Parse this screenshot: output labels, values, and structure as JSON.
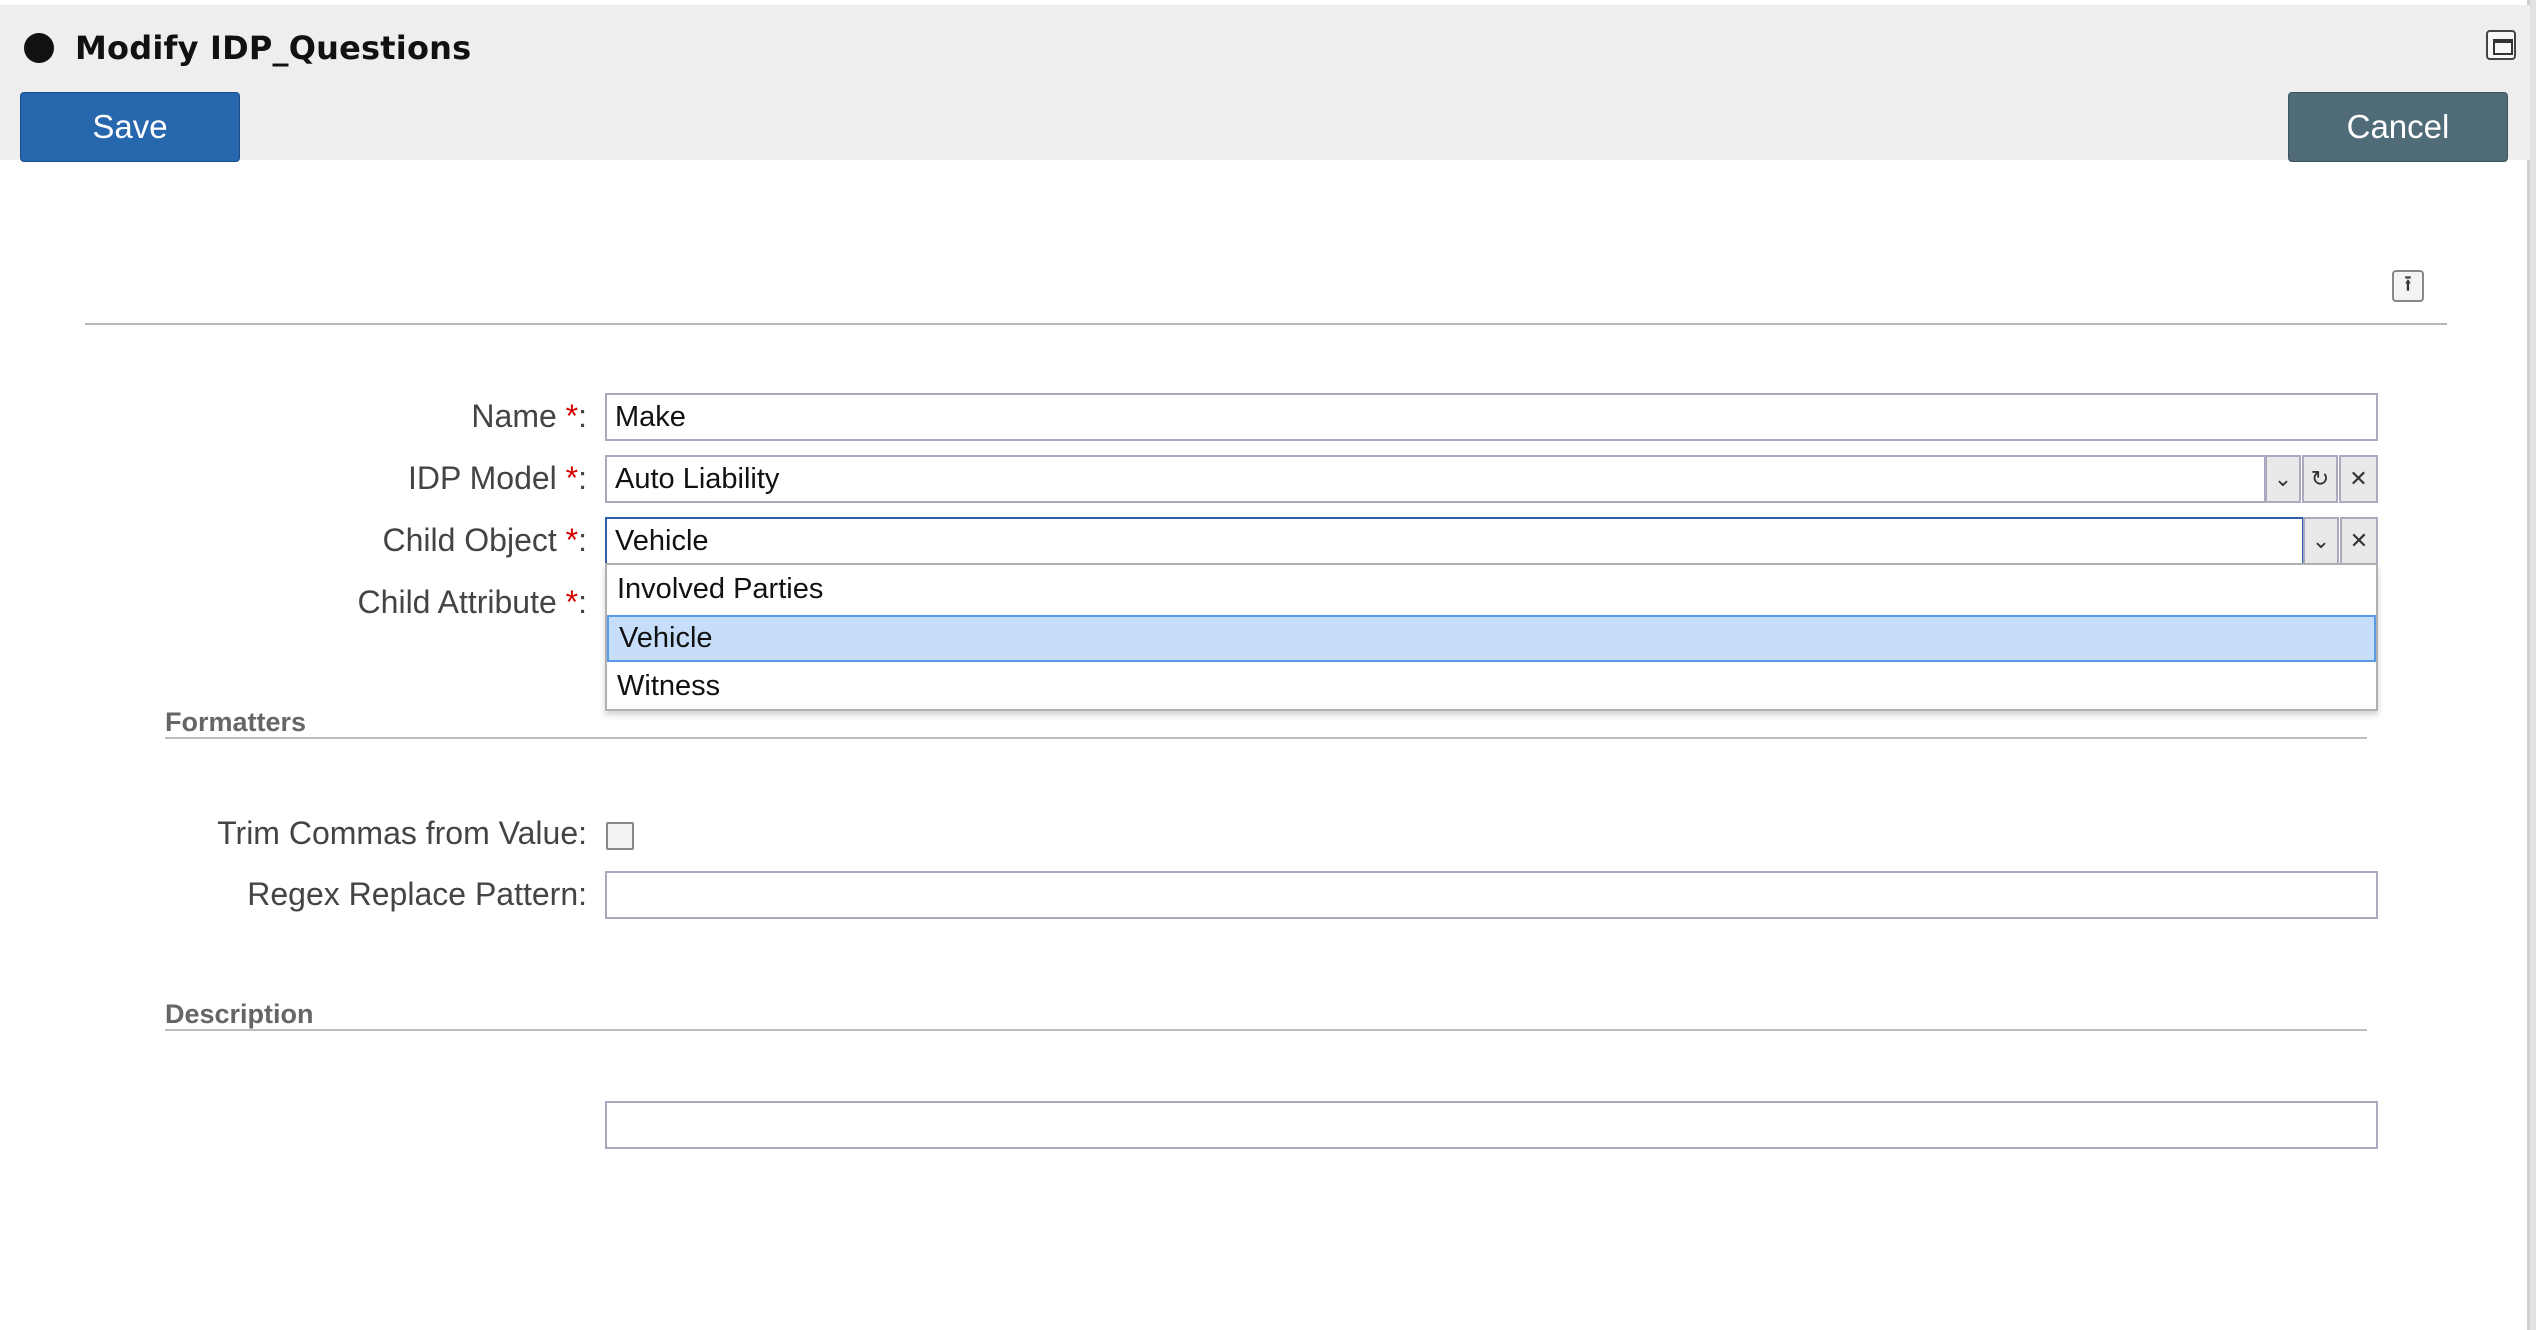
{
  "dialog": {
    "title": "Modify IDP_Questions"
  },
  "toolbar": {
    "save_label": "Save",
    "cancel_label": "Cancel"
  },
  "form": {
    "name": {
      "label": "Name ",
      "required": "*",
      "colon": ":",
      "value": "Make"
    },
    "idp_model": {
      "label": "IDP Model ",
      "required": "*",
      "colon": ":",
      "value": "Auto Liability"
    },
    "child_object": {
      "label": "Child Object ",
      "required": "*",
      "colon": ":",
      "value": "Vehicle"
    },
    "child_attribute": {
      "label": "Child Attribute ",
      "required": "*",
      "colon": ":"
    }
  },
  "dropdown": {
    "options": [
      "Involved Parties",
      "Vehicle",
      "Witness"
    ],
    "selected": "Vehicle"
  },
  "formatters": {
    "title": "Formatters",
    "trim_commas_label": "Trim Commas from Value:",
    "trim_commas_checked": false,
    "regex_label": "Regex Replace Pattern:",
    "regex_value": ""
  },
  "description": {
    "title": "Description",
    "value": ""
  },
  "icons": {
    "dropdown_arrow": "chevron-down-icon",
    "refresh": "refresh-icon",
    "clear": "clear-icon",
    "collapse": "collapse-up-icon",
    "maximize": "maximize-icon"
  },
  "colors": {
    "save_bg": "#2767ad",
    "cancel_bg": "#506c79",
    "required": "#d40000",
    "selected_option": "#c6def9"
  }
}
